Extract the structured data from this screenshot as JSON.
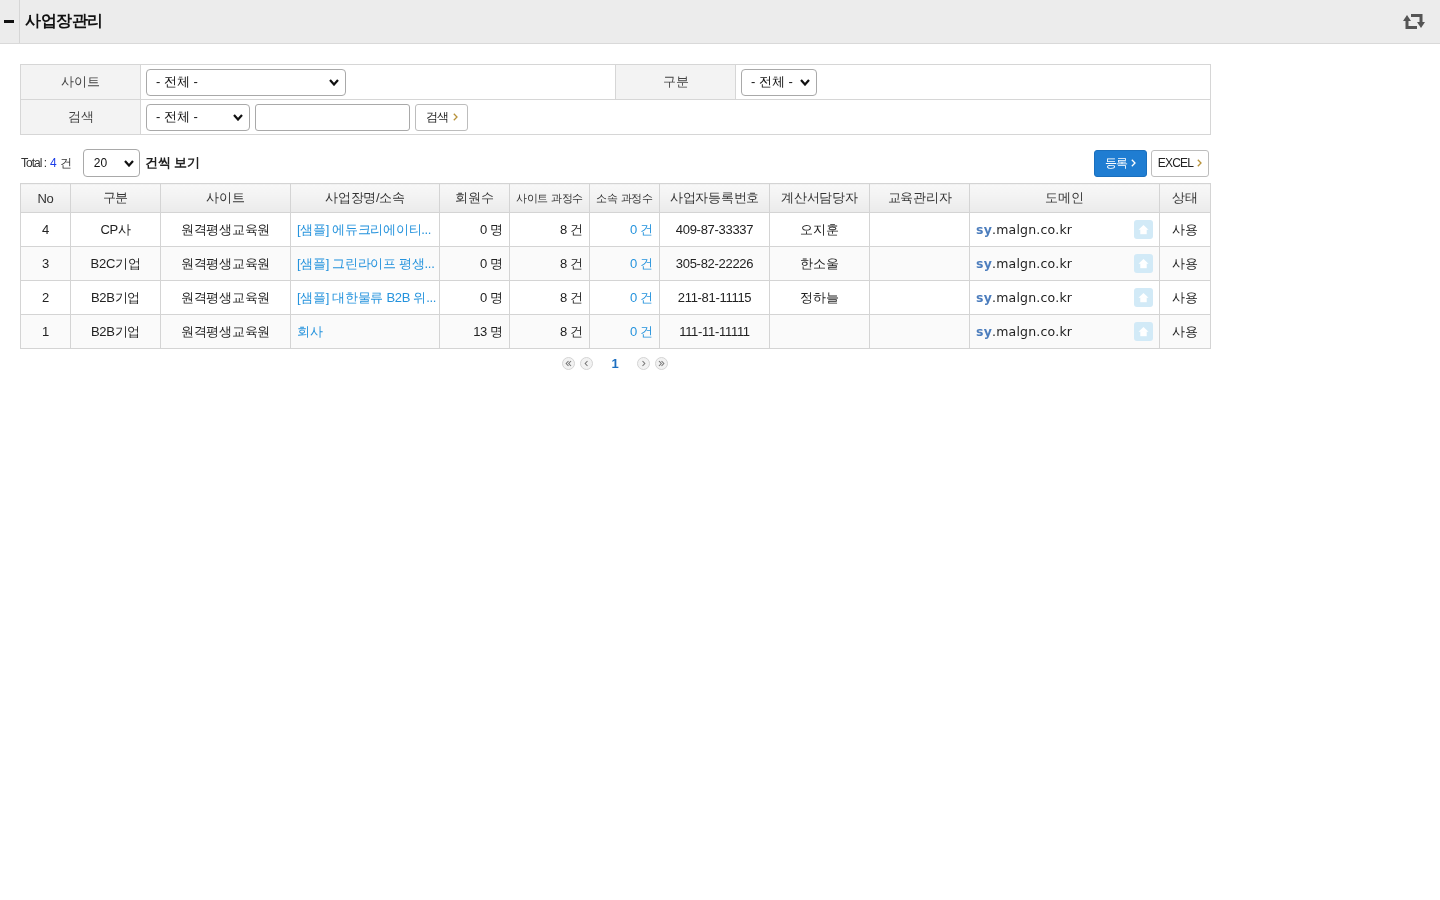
{
  "header": {
    "title": "사업장관리"
  },
  "filters": [
    {
      "cells": [
        {
          "label": "사이트",
          "controls": [
            {
              "kind": "select",
              "value": "- 전체 -"
            }
          ]
        },
        {
          "label": "구분",
          "controls": [
            {
              "kind": "select",
              "value": "- 전체 -"
            }
          ]
        }
      ]
    },
    {
      "cells": [
        {
          "label": "검색",
          "controls": [
            {
              "kind": "select",
              "value": "- 전체 -"
            },
            {
              "kind": "input"
            },
            {
              "kind": "button",
              "label": "검색"
            }
          ]
        }
      ]
    }
  ],
  "toolbar": {
    "total": {
      "label": "Total :",
      "count": "4",
      "unit": "건"
    },
    "per_page": {
      "value": "20",
      "suffix": "건씩 보기"
    },
    "actions": [
      {
        "kind": "primary",
        "label": "등록"
      },
      {
        "kind": "secondary",
        "label": "EXCEL"
      }
    ]
  },
  "table": {
    "columns": [
      "No",
      "구분",
      "사이트",
      "사업장명/소속",
      "회원수",
      "사이트 과정수",
      "소속 과정수",
      "사업자등록번호",
      "계산서담당자",
      "교육관리자",
      "도메인",
      "상태"
    ],
    "rows": [
      {
        "no": "4",
        "type": "CP사",
        "site": "원격평생교육원",
        "name": "[샘플] 에듀크리에이티...",
        "members": "0 명",
        "site_courses": "8 건",
        "org_courses": "0 건",
        "business_number": "409-87-33337",
        "invoice_manager": "오지훈",
        "domain": "**sy**.malgn.co.kr",
        "status": "사용"
      },
      {
        "no": "3",
        "type": "B2C기업",
        "site": "원격평생교육원",
        "name": "[샘플] 그린라이프 평생...",
        "members": "0 명",
        "site_courses": "8 건",
        "org_courses": "0 건",
        "business_number": "305-82-22226",
        "invoice_manager": "한소울",
        "domain": "**sy**.malgn.co.kr",
        "status": "사용"
      },
      {
        "no": "2",
        "type": "B2B기업",
        "site": "원격평생교육원",
        "name": "[샘플] 대한물류 B2B 위...",
        "members": "0 명",
        "site_courses": "8 건",
        "org_courses": "0 건",
        "business_number": "211-81-11115",
        "invoice_manager": "정하늘",
        "domain": "**sy**.malgn.co.kr",
        "status": "사용"
      },
      {
        "no": "1",
        "type": "B2B기업",
        "site": "원격평생교육원",
        "name": "회사",
        "members": "13 명",
        "site_courses": "8 건",
        "org_courses": "0 건",
        "business_number": "111-11-11111",
        "domain": "**sy**.malgn.co.kr",
        "status": "사용"
      }
    ]
  },
  "pagination": {
    "pages": [
      {
        "label": "1",
        "selected": true
      }
    ]
  }
}
